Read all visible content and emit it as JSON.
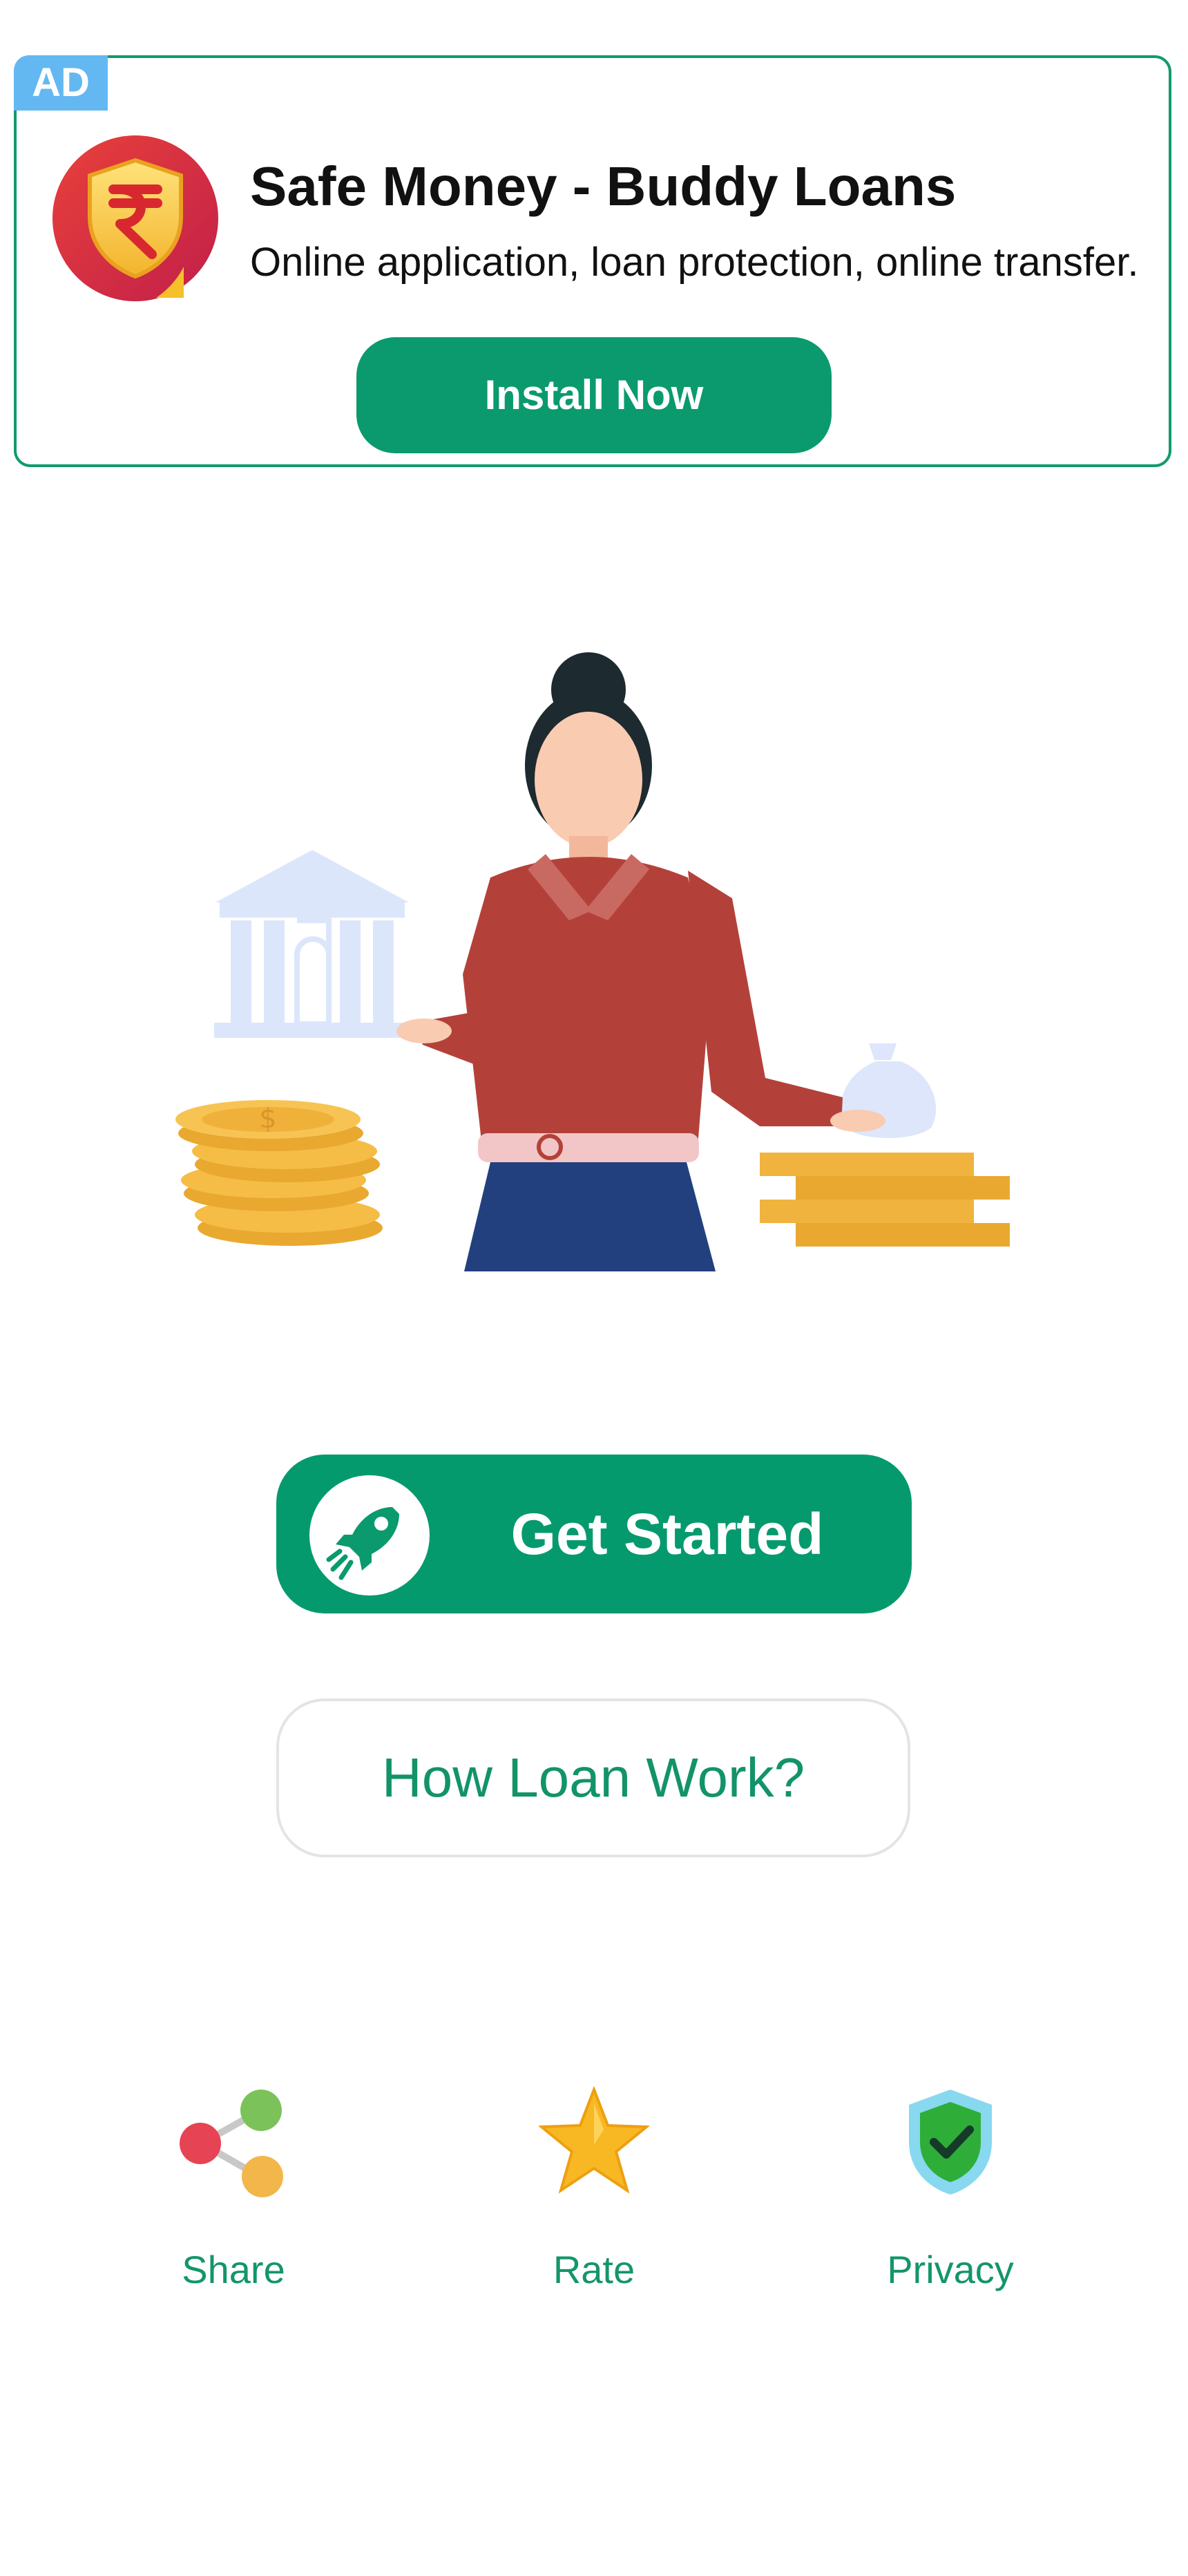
{
  "ad": {
    "badge": "AD",
    "logo_icon": "rupee-shield-icon",
    "title": "Safe Money - Buddy Loans",
    "subtitle": "Online application, loan protection, online transfer.",
    "install_label": "Install Now",
    "accent_color": "#0a9a6e",
    "badge_color": "#63b8f2"
  },
  "hero": {
    "illustration": "woman-with-bank-coins-illustration"
  },
  "actions": {
    "get_started_label": "Get Started",
    "get_started_icon": "rocket-icon",
    "how_loan_work_label": "How Loan Work?"
  },
  "bottom_nav": [
    {
      "label": "Share",
      "icon": "share-icon"
    },
    {
      "label": "Rate",
      "icon": "star-icon"
    },
    {
      "label": "Privacy",
      "icon": "shield-check-icon"
    }
  ],
  "colors": {
    "primary_green": "#059a6e",
    "text_green": "#14956c",
    "outline_gray": "#e4e4e4"
  }
}
